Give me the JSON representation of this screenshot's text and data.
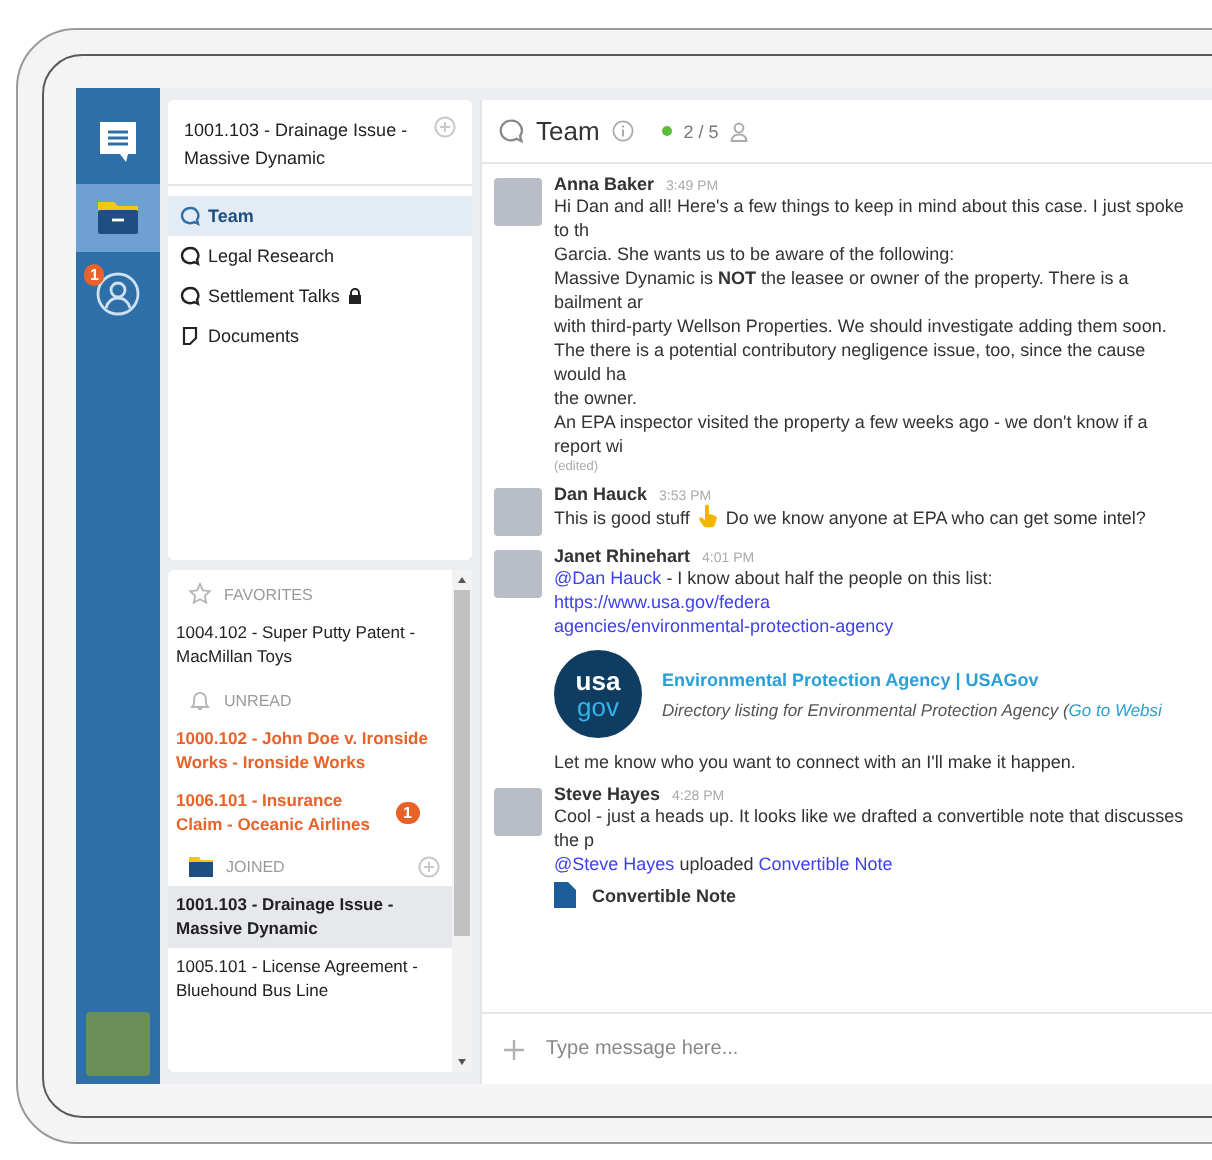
{
  "rail": {
    "items": [
      {
        "kind": "chat",
        "selected": false
      },
      {
        "kind": "folder",
        "selected": true
      },
      {
        "kind": "contacts",
        "selected": false,
        "badge": "1"
      }
    ]
  },
  "matter": {
    "title": "1001.103 - Drainage Issue - Massive Dynamic"
  },
  "channels": [
    {
      "kind": "chat",
      "label": "Team",
      "selected": true,
      "locked": false
    },
    {
      "kind": "chat",
      "label": "Legal Research",
      "selected": false,
      "locked": false
    },
    {
      "kind": "chat",
      "label": "Settlement Talks",
      "selected": false,
      "locked": true
    },
    {
      "kind": "document",
      "label": "Documents",
      "selected": false,
      "locked": false
    }
  ],
  "sections": [
    {
      "kind": "favorites",
      "title": "FAVORITES",
      "add": false,
      "items": [
        {
          "label": "1004.102 - Super Putty Patent - MacMillan Toys",
          "unread": false,
          "selected": false
        }
      ]
    },
    {
      "kind": "unread",
      "title": "UNREAD",
      "add": false,
      "items": [
        {
          "label": "1000.102 - John Doe v. Ironside Works - Ironside Works",
          "unread": true,
          "selected": false
        },
        {
          "label": "1006.101 - Insurance Claim - Oceanic Airlines",
          "unread": true,
          "selected": false,
          "badge": "1"
        }
      ]
    },
    {
      "kind": "joined",
      "title": "JOINED",
      "add": true,
      "items": [
        {
          "label": "1001.103 - Drainage Issue - Massive Dynamic",
          "unread": false,
          "selected": true
        },
        {
          "label": "1005.101 - License Agreement - Bluehound Bus Line",
          "unread": false,
          "selected": false
        }
      ]
    }
  ],
  "chat": {
    "title": "Team",
    "online": "2 / 5",
    "messages": [
      {
        "author": "Anna Baker",
        "time": "3:49 PM",
        "edited_label": "(edited)",
        "blocks": [
          {
            "kind": "lines",
            "lines": [
              [
                {
                  "kind": "text",
                  "text": "Hi Dan and all! Here's a few things to keep in mind about this case. I just spoke to th"
                }
              ],
              [
                {
                  "kind": "text",
                  "text": "Garcia. She wants us to be aware of the following:"
                }
              ],
              [
                {
                  "kind": "text",
                  "text": "Massive Dynamic is **NOT** the leasee or owner of the property. There is a bailment ar"
                }
              ],
              [
                {
                  "kind": "text",
                  "text": "with third-party Wellson Properties. We should investigate adding them soon."
                }
              ],
              [
                {
                  "kind": "text",
                  "text": "The there is a potential contributory negligence issue, too, since the cause would ha"
                }
              ],
              [
                {
                  "kind": "text",
                  "text": "the owner."
                }
              ],
              [
                {
                  "kind": "text",
                  "text": "An EPA inspector visited the property a few weeks ago - we don't know if a report wi"
                }
              ]
            ]
          }
        ]
      },
      {
        "author": "Dan Hauck",
        "time": "3:53 PM",
        "blocks": [
          {
            "kind": "lines",
            "lines": [
              [
                {
                  "kind": "text",
                  "text": "This is good stuff"
                },
                {
                  "kind": "hand"
                },
                {
                  "kind": "text",
                  "text": "Do we know anyone at EPA who can get some intel?"
                }
              ]
            ]
          }
        ]
      },
      {
        "author": "Janet Rhinehart",
        "time": "4:01 PM",
        "blocks": [
          {
            "kind": "lines",
            "lines": [
              [
                {
                  "kind": "mention",
                  "text": "@Dan Hauck"
                },
                {
                  "kind": "text",
                  "text": "- I know about half the people on this list:"
                },
                {
                  "kind": "link",
                  "text": "https://www.usa.gov/federa"
                }
              ],
              [
                {
                  "kind": "link",
                  "text": "agencies/environmental-protection-agency"
                }
              ]
            ]
          },
          {
            "kind": "preview",
            "logo_lines": [
              "usa",
              "gov"
            ],
            "title": "Environmental Protection Agency | USAGov",
            "description": "Directory listing for Environmental Protection Agency (",
            "link": "Go to Websi"
          },
          {
            "kind": "lines",
            "lines": [
              [
                {
                  "kind": "text",
                  "text": "Let me know who you want to connect with an I'll make it happen."
                }
              ]
            ]
          }
        ]
      },
      {
        "author": "Steve Hayes",
        "time": "4:28 PM",
        "blocks": [
          {
            "kind": "lines",
            "lines": [
              [
                {
                  "kind": "text",
                  "text": "Cool - just a heads up. It looks like we drafted a convertible note that discusses the p"
                }
              ],
              [
                {
                  "kind": "mention",
                  "text": "@Steve Hayes"
                },
                {
                  "kind": "text",
                  "text": "uploaded"
                },
                {
                  "kind": "link",
                  "text": "Convertible Note"
                }
              ]
            ]
          },
          {
            "kind": "file",
            "title": "Convertible Note"
          }
        ]
      }
    ],
    "composer": {
      "placeholder": "Type message here..."
    }
  }
}
